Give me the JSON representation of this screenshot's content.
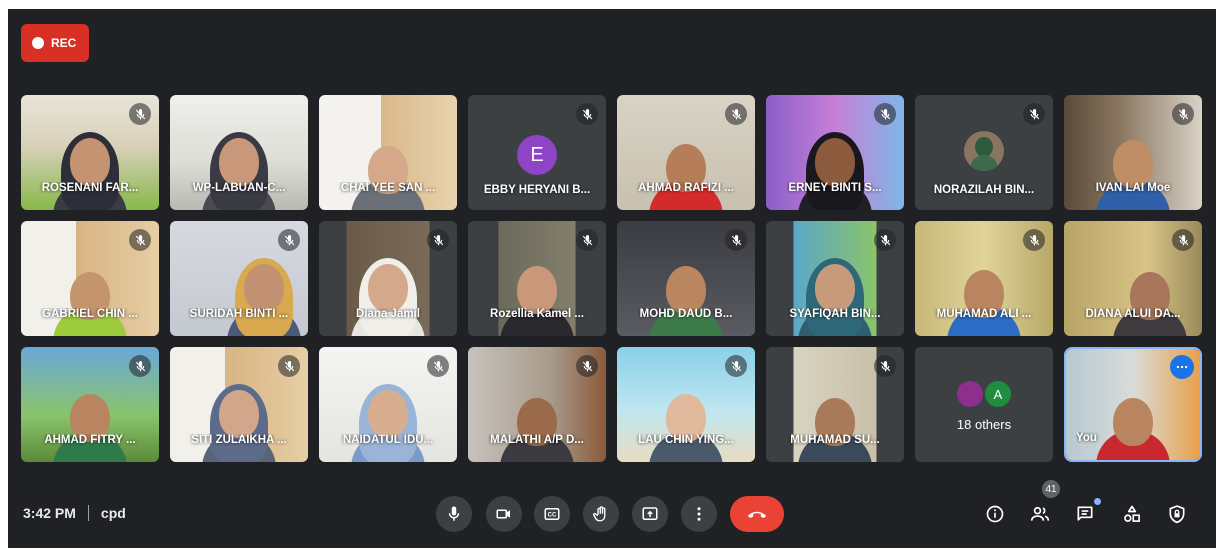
{
  "recording": {
    "label": "REC"
  },
  "participants": [
    {
      "name": "ROSENANI FAR...",
      "muted": true
    },
    {
      "name": "WP-LABUAN-C...",
      "muted": false
    },
    {
      "name": "CHAI YEE SAN ...",
      "muted": false
    },
    {
      "name": "EBBY HERYANI B...",
      "muted": true,
      "avatar_letter": "E"
    },
    {
      "name": "AHMAD RAFIZI ...",
      "muted": true
    },
    {
      "name": "ERNEY BINTI S...",
      "muted": true
    },
    {
      "name": "NORAZILAH BIN...",
      "muted": true
    },
    {
      "name": "IVAN LAI Moe",
      "muted": true
    },
    {
      "name": "GABRIEL CHIN ...",
      "muted": true
    },
    {
      "name": "SURIDAH BINTI ...",
      "muted": true
    },
    {
      "name": "Diana Jamil",
      "muted": true
    },
    {
      "name": "Rozellia Kamel ...",
      "muted": true
    },
    {
      "name": "MOHD DAUD B...",
      "muted": true
    },
    {
      "name": "SYAFIQAH BIN...",
      "muted": true
    },
    {
      "name": "MUHAMAD ALI ...",
      "muted": true
    },
    {
      "name": "DIANA ALUI DA...",
      "muted": true
    },
    {
      "name": "AHMAD FITRY ...",
      "muted": true
    },
    {
      "name": "SITI ZULAIKHA ...",
      "muted": true
    },
    {
      "name": "NAIDATUL IDU...",
      "muted": true
    },
    {
      "name": "MALATHI A/P D...",
      "muted": true
    },
    {
      "name": "LAU CHIN YING...",
      "muted": true
    },
    {
      "name": "MUHAMAD SU...",
      "muted": true
    }
  ],
  "others_tile": {
    "label": "18 others",
    "avatar_letter": "A"
  },
  "self_tile": {
    "name": "You"
  },
  "bottom_bar": {
    "time": "3:42 PM",
    "meeting_code": "cpd",
    "participant_count": "41",
    "controls": [
      "mic",
      "camera",
      "captions",
      "raise-hand",
      "present",
      "more-options",
      "leave-call"
    ],
    "right_icons": [
      "meeting-details",
      "people",
      "chat",
      "activities",
      "host-controls"
    ]
  },
  "colors": {
    "background": "#202124",
    "tile": "#3c4043",
    "rec": "#d93025",
    "end_call": "#ea4335",
    "accent": "#8ab4f8"
  }
}
